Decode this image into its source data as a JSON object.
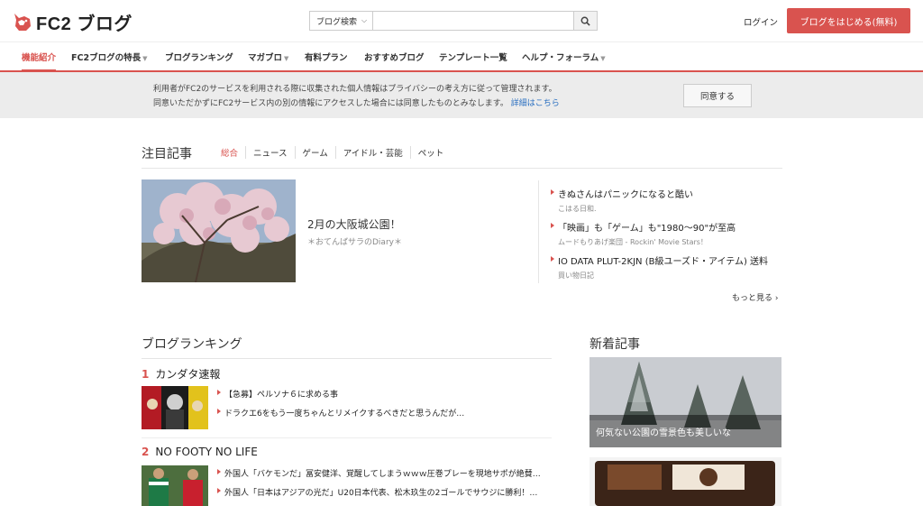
{
  "header": {
    "logo_text": "FC2 ブログ",
    "search_select": "ブログ検索",
    "search_placeholder": "",
    "login": "ログイン",
    "start_button": "ブログをはじめる(無料)"
  },
  "nav": {
    "items": [
      {
        "label": "機能紹介"
      },
      {
        "label": "FC2ブログの特長"
      },
      {
        "label": "ブログランキング"
      },
      {
        "label": "マガブロ"
      },
      {
        "label": "有料プラン"
      },
      {
        "label": "おすすめブログ"
      },
      {
        "label": "テンプレート一覧"
      },
      {
        "label": "ヘルプ・フォーラム"
      }
    ]
  },
  "privacy": {
    "line1": "利用者がFC2のサービスを利用される際に収集された個人情報はプライバシーの考え方に従って管理されます。",
    "line2": "同意いただかずにFC2サービス内の別の情報にアクセスした場合には同意したものとみなします。",
    "link": "詳細はこちら",
    "agree_button": "同意する"
  },
  "featured": {
    "title": "注目記事",
    "tabs": [
      "総合",
      "ニュース",
      "ゲーム",
      "アイドル・芸能",
      "ペット"
    ],
    "main_article": {
      "title": "2月の大阪城公園！",
      "source": "＊おてんばサラのDiary＊"
    },
    "list": [
      {
        "title": "きぬさんはパニックになると酷い",
        "source": "こはる日和."
      },
      {
        "title": "「映画」も「ゲーム」も\"1980〜90\"が至高",
        "source": "ムードもりあげ楽団 - Rockin' Movie Stars！"
      },
      {
        "title": "IO DATA PLUT-2KJN (B級ユーズド・アイテム) 送料",
        "source": "買い物日記"
      }
    ],
    "more": "もっと見る ›"
  },
  "ranking": {
    "title": "ブログランキング",
    "blogs": [
      {
        "rank": "1",
        "name": "カンダタ速報",
        "items": [
          "【急募】ペルソナ６に求める事",
          "ドラクエ6をもう一度ちゃんとリメイクするべきだと思うんだが…"
        ]
      },
      {
        "rank": "2",
        "name": "NO FOOTY NO LIFE",
        "items": [
          "外国人「バケモンだ」冨安健洋、覚醒してしまうｗｗｗ圧巻プレーを現地サポが絶賛…",
          "外国人「日本はアジアの光だ」U20日本代表、松木玖生の2ゴールでサウジに勝利！…"
        ]
      }
    ]
  },
  "new_articles": {
    "title": "新着記事",
    "card1_caption": "何気ない公園の雪景色も美しいな"
  },
  "colors": {
    "accent": "#d9534f",
    "link": "#2a6fc0",
    "banner_bg": "#ececec"
  }
}
